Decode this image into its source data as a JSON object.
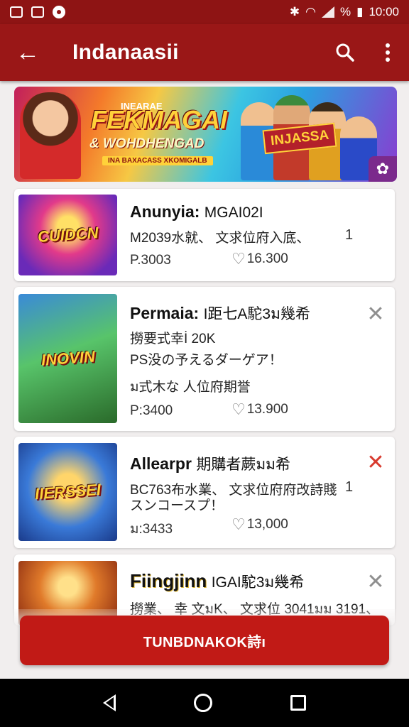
{
  "status_bar": {
    "battery": "%",
    "time": "10:00"
  },
  "app_bar": {
    "back_icon": "arrow-left-icon",
    "title": "Indanaasii",
    "search_icon": "search-icon",
    "more_icon": "more-vertical-icon"
  },
  "banner": {
    "kicker": "INEARAE",
    "title": "FEKMAGAI",
    "subtitle": "& WOHDHENGAD",
    "strip": "INA BAXACASS XKOMIGALB",
    "sign": "INJASSA"
  },
  "cards": [
    {
      "thumb_label": "CUIDCN",
      "title": "Anunyia:",
      "title_rest": "MGAI02I",
      "lines": [
        "M2039水就、 文求位府入底、"
      ],
      "mark": "1",
      "price": "P.3003",
      "likes": "16.300"
    },
    {
      "thumb_label": "INOVIN",
      "title": "Permaia:",
      "title_rest": "I距七A駝3ม幾希",
      "lines": [
        "撈要式幸İ 20K",
        "PS没の予えるダーゲア！",
        "ม式木な 人位府期誉"
      ],
      "mark": "",
      "price": "P:3400",
      "likes": "13.900"
    },
    {
      "thumb_label": "IIERSSEI",
      "title": "Allearpr",
      "title_rest": "期購者蕨มม希",
      "lines": [
        "BC763布水業、 文求位府府改詩賤",
        "スンコースプ！"
      ],
      "mark": "1",
      "price": "ม:3433",
      "likes": "13,000"
    },
    {
      "thumb_label": "",
      "title": "Fiingjinn",
      "title_rest": "IGAI駝3ม幾希",
      "lines": [
        "撈業、 幸 文มK、 文求位 3041มม 3191、"
      ],
      "mark": "",
      "price": "",
      "likes": ""
    }
  ],
  "cta": {
    "label": "TUNBDNAKOK詩ı"
  },
  "nav_bar": {
    "back_icon": "nav-back-icon",
    "home_icon": "nav-home-icon",
    "recents_icon": "nav-recents-icon"
  }
}
